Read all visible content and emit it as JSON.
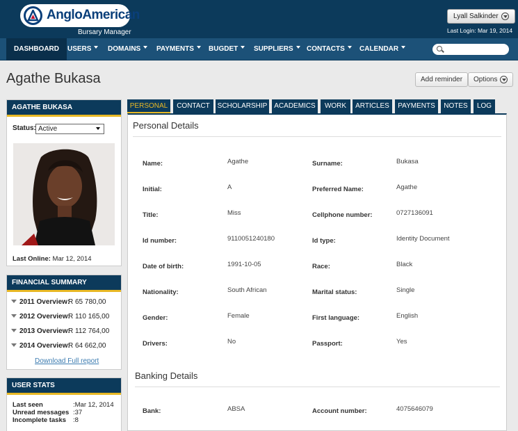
{
  "header": {
    "logo_text": "AngloAmerican",
    "subtitle": "Bursary Manager",
    "user_name": "Lyall Salkinder",
    "last_login_label": "Last Login:",
    "last_login_value": "Mar 19, 2014"
  },
  "nav": {
    "items": [
      {
        "label": "DASHBOARD"
      },
      {
        "label": "USERS"
      },
      {
        "label": "DOMAINS"
      },
      {
        "label": "PAYMENTS"
      },
      {
        "label": "BUGDET"
      },
      {
        "label": "SUPPLIERS"
      },
      {
        "label": "CONTACTS"
      },
      {
        "label": "CALENDAR"
      }
    ],
    "search_placeholder": ""
  },
  "page": {
    "title": "Agathe Bukasa",
    "add_reminder": "Add reminder",
    "options": "Options"
  },
  "profile": {
    "heading": "AGATHE BUKASA",
    "status_label": "Status:",
    "status_value": "Active",
    "last_online_label": "Last Online:",
    "last_online_value": "Mar 12, 2014"
  },
  "financial": {
    "heading": "FINANCIAL SUMMARY",
    "rows": [
      {
        "label": "2011 Overview:",
        "value": "R 65 780,00"
      },
      {
        "label": "2012 Overview:",
        "value": "R 110 165,00"
      },
      {
        "label": "2013 Overview:",
        "value": "R 112 764,00"
      },
      {
        "label": "2014 Overview:",
        "value": "R 64 662,00"
      }
    ],
    "download_link": "Download Full report"
  },
  "stats": {
    "heading": "USER STATS",
    "rows": [
      {
        "label": "Last seen",
        "value": ":Mar 12, 2014"
      },
      {
        "label": "Unread messages",
        "value": ":37"
      },
      {
        "label": "Incomplete tasks",
        "value": ":8"
      }
    ]
  },
  "tabs": [
    {
      "label": "PERSONAL"
    },
    {
      "label": "CONTACT"
    },
    {
      "label": "SCHOLARSHIP"
    },
    {
      "label": "ACADEMICS"
    },
    {
      "label": "WORK"
    },
    {
      "label": "ARTICLES"
    },
    {
      "label": "PAYMENTS"
    },
    {
      "label": "NOTES"
    },
    {
      "label": "LOG"
    }
  ],
  "personal": {
    "title": "Personal Details",
    "fields": [
      {
        "label": "Name:",
        "value": "Agathe"
      },
      {
        "label": "Surname:",
        "value": "Bukasa"
      },
      {
        "label": "Initial:",
        "value": "A"
      },
      {
        "label": "Preferred Name:",
        "value": "Agathe"
      },
      {
        "label": "Title:",
        "value": "Miss"
      },
      {
        "label": "Cellphone number:",
        "value": "0727136091"
      },
      {
        "label": "Id number:",
        "value": "9110051240180"
      },
      {
        "label": "Id type:",
        "value": "Identity Document"
      },
      {
        "label": "Date of birth:",
        "value": "1991-10-05"
      },
      {
        "label": "Race:",
        "value": "Black"
      },
      {
        "label": "Nationality:",
        "value": "South African"
      },
      {
        "label": "Marital status:",
        "value": "Single"
      },
      {
        "label": "Gender:",
        "value": "Female"
      },
      {
        "label": "First language:",
        "value": "English"
      },
      {
        "label": "Drivers:",
        "value": "No"
      },
      {
        "label": "Passport:",
        "value": "Yes"
      }
    ]
  },
  "banking": {
    "title": "Banking Details",
    "fields": [
      {
        "label": "Bank:",
        "value": "ABSA"
      },
      {
        "label": "Account number:",
        "value": "4075646079"
      }
    ]
  },
  "colors": {
    "navy": "#0c3a5b",
    "nav_blue": "#1c5178",
    "accent": "#e8b824",
    "link": "#3b7bb0"
  },
  "icons": [
    "logo-mark-icon",
    "download-circle-icon",
    "chevron-down-icon",
    "search-icon",
    "triangle-down-icon",
    "profile-photo"
  ]
}
